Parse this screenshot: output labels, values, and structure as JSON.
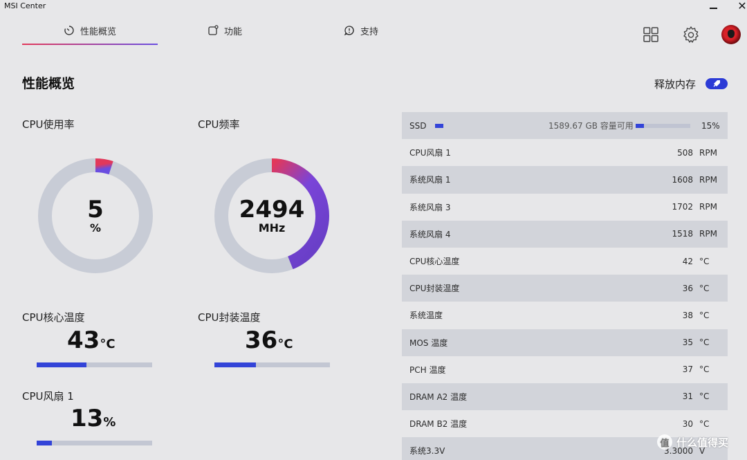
{
  "window": {
    "title": "MSI Center"
  },
  "tabs": [
    {
      "label": "性能概览",
      "icon": "gauge-icon",
      "active": true
    },
    {
      "label": "功能",
      "icon": "feature-icon",
      "active": false
    },
    {
      "label": "支持",
      "icon": "support-icon",
      "active": false
    }
  ],
  "header_icons": [
    "grid-icon",
    "gear-icon",
    "avatar"
  ],
  "page": {
    "title": "性能概览",
    "free_memory_label": "释放内存"
  },
  "gauges": {
    "cpu_usage": {
      "title": "CPU使用率",
      "value": "5",
      "unit": "%",
      "fraction": 0.05
    },
    "cpu_freq": {
      "title": "CPU频率",
      "value": "2494",
      "unit": "MHz",
      "fraction": 0.44
    }
  },
  "stats": {
    "cpu_core_temp": {
      "title": "CPU核心温度",
      "value": "43",
      "unit": "°C",
      "fraction": 0.43
    },
    "cpu_package_temp": {
      "title": "CPU封装温度",
      "value": "36",
      "unit": "°C",
      "fraction": 0.36
    },
    "cpu_fan1": {
      "title": "CPU风扇 1",
      "value": "13",
      "unit": "%",
      "fraction": 0.13
    }
  },
  "ssd": {
    "name": "SSD",
    "capacity": "1589.67 GB 容量可用",
    "percent": "15%",
    "fraction": 0.15
  },
  "sensors": [
    {
      "name": "CPU风扇 1",
      "value": "508",
      "unit": "RPM"
    },
    {
      "name": "系统风扇 1",
      "value": "1608",
      "unit": "RPM"
    },
    {
      "name": "系统风扇 3",
      "value": "1702",
      "unit": "RPM"
    },
    {
      "name": "系统风扇 4",
      "value": "1518",
      "unit": "RPM"
    },
    {
      "name": "CPU核心温度",
      "value": "42",
      "unit": "°C"
    },
    {
      "name": "CPU封装温度",
      "value": "36",
      "unit": "°C"
    },
    {
      "name": "系统温度",
      "value": "38",
      "unit": "°C"
    },
    {
      "name": "MOS 温度",
      "value": "35",
      "unit": "°C"
    },
    {
      "name": "PCH 温度",
      "value": "37",
      "unit": "°C"
    },
    {
      "name": "DRAM A2 温度",
      "value": "31",
      "unit": "°C"
    },
    {
      "name": "DRAM B2 温度",
      "value": "30",
      "unit": "°C"
    },
    {
      "name": "系统3.3V",
      "value": "3.3000",
      "unit": "V"
    }
  ],
  "watermark": {
    "text": "什么值得买",
    "glyph": "值"
  },
  "colors": {
    "accent": "#3344d8",
    "gradient_start": "#e2385a",
    "gradient_end": "#6a4de0",
    "track": "#c8ccd6"
  }
}
